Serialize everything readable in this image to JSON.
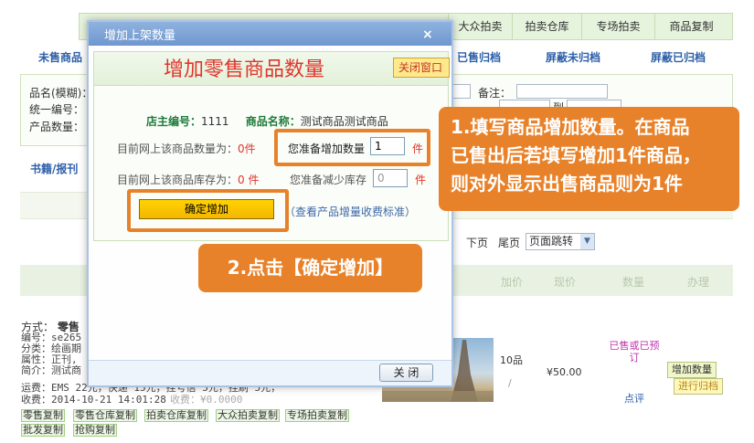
{
  "background": {
    "tabs": [
      "大众拍卖",
      "拍卖仓库",
      "专场拍卖",
      "商品复制"
    ],
    "subtabs": [
      "未售商品",
      "已售归档",
      "屏蔽未归档",
      "屏蔽已归档"
    ],
    "filter_labels": {
      "name": "品名(模糊)：",
      "code": "统一编号：",
      "quantity": "产品数量：",
      "remark": "备注：",
      "to": "到"
    },
    "category_link": "书籍/报刊",
    "pager": {
      "next": "下页",
      "last": "尾页",
      "jump": "页面跳转"
    },
    "table_headers": [
      "加价",
      "现价",
      "数量",
      "办理"
    ],
    "item": {
      "method_label": "方式：",
      "method_value": "零售",
      "lines": [
        "编号：se265",
        "分类：绘画期",
        "属性：正刊,",
        "简介：测试商"
      ],
      "shipping": "运费：EMS 22元，快递 15元，挂号信 5元，挂刷 5元，",
      "date_line": "收费：2014-10-21 14:01:28",
      "fee_text": "收费：¥0.0000",
      "quantity_text": "10品",
      "slash": "/",
      "price": "¥50.00",
      "status": "已售或已预订",
      "review": "点评",
      "buttons": [
        "增加数量",
        "进行归档"
      ],
      "copy_links": [
        "零售复制",
        "零售仓库复制",
        "拍卖仓库复制",
        "大众拍卖复制",
        "专场拍卖复制",
        "批发复制",
        "抢购复制"
      ]
    }
  },
  "modal": {
    "title": "增加上架数量",
    "close_symbol": "×",
    "heading": "增加零售商品数量",
    "close_window": "关闭窗口",
    "shop_label": "店主编号：",
    "shop_id": "1111",
    "product_label": "商品名称：",
    "product_name": "测试商品测试商品",
    "listed_label": "目前网上该商品数量为：",
    "listed_value": "0",
    "stock_label": "目前网上该商品库存为：",
    "stock_value": "0",
    "unit": "件",
    "add_label": "您准备增加数量",
    "add_value": "1",
    "reduce_label": "您准备减少库存",
    "reduce_value": "0",
    "confirm": "确定增加",
    "fee_link": "（查看产品增量收费标准）",
    "footer_close": "关 闭"
  },
  "callouts": {
    "step1": [
      "1.填写商品增加数量。在商品",
      "已售出后若填写增加1件商品，",
      "则对外显示出售商品则为1件"
    ],
    "step2": "2.点击【确定增加】"
  },
  "colors": {
    "accent_orange": "#e8822a",
    "heading_red": "#e0352b",
    "confirm_yellow": "#ffd200",
    "title_blue": "#7ba0d6"
  }
}
